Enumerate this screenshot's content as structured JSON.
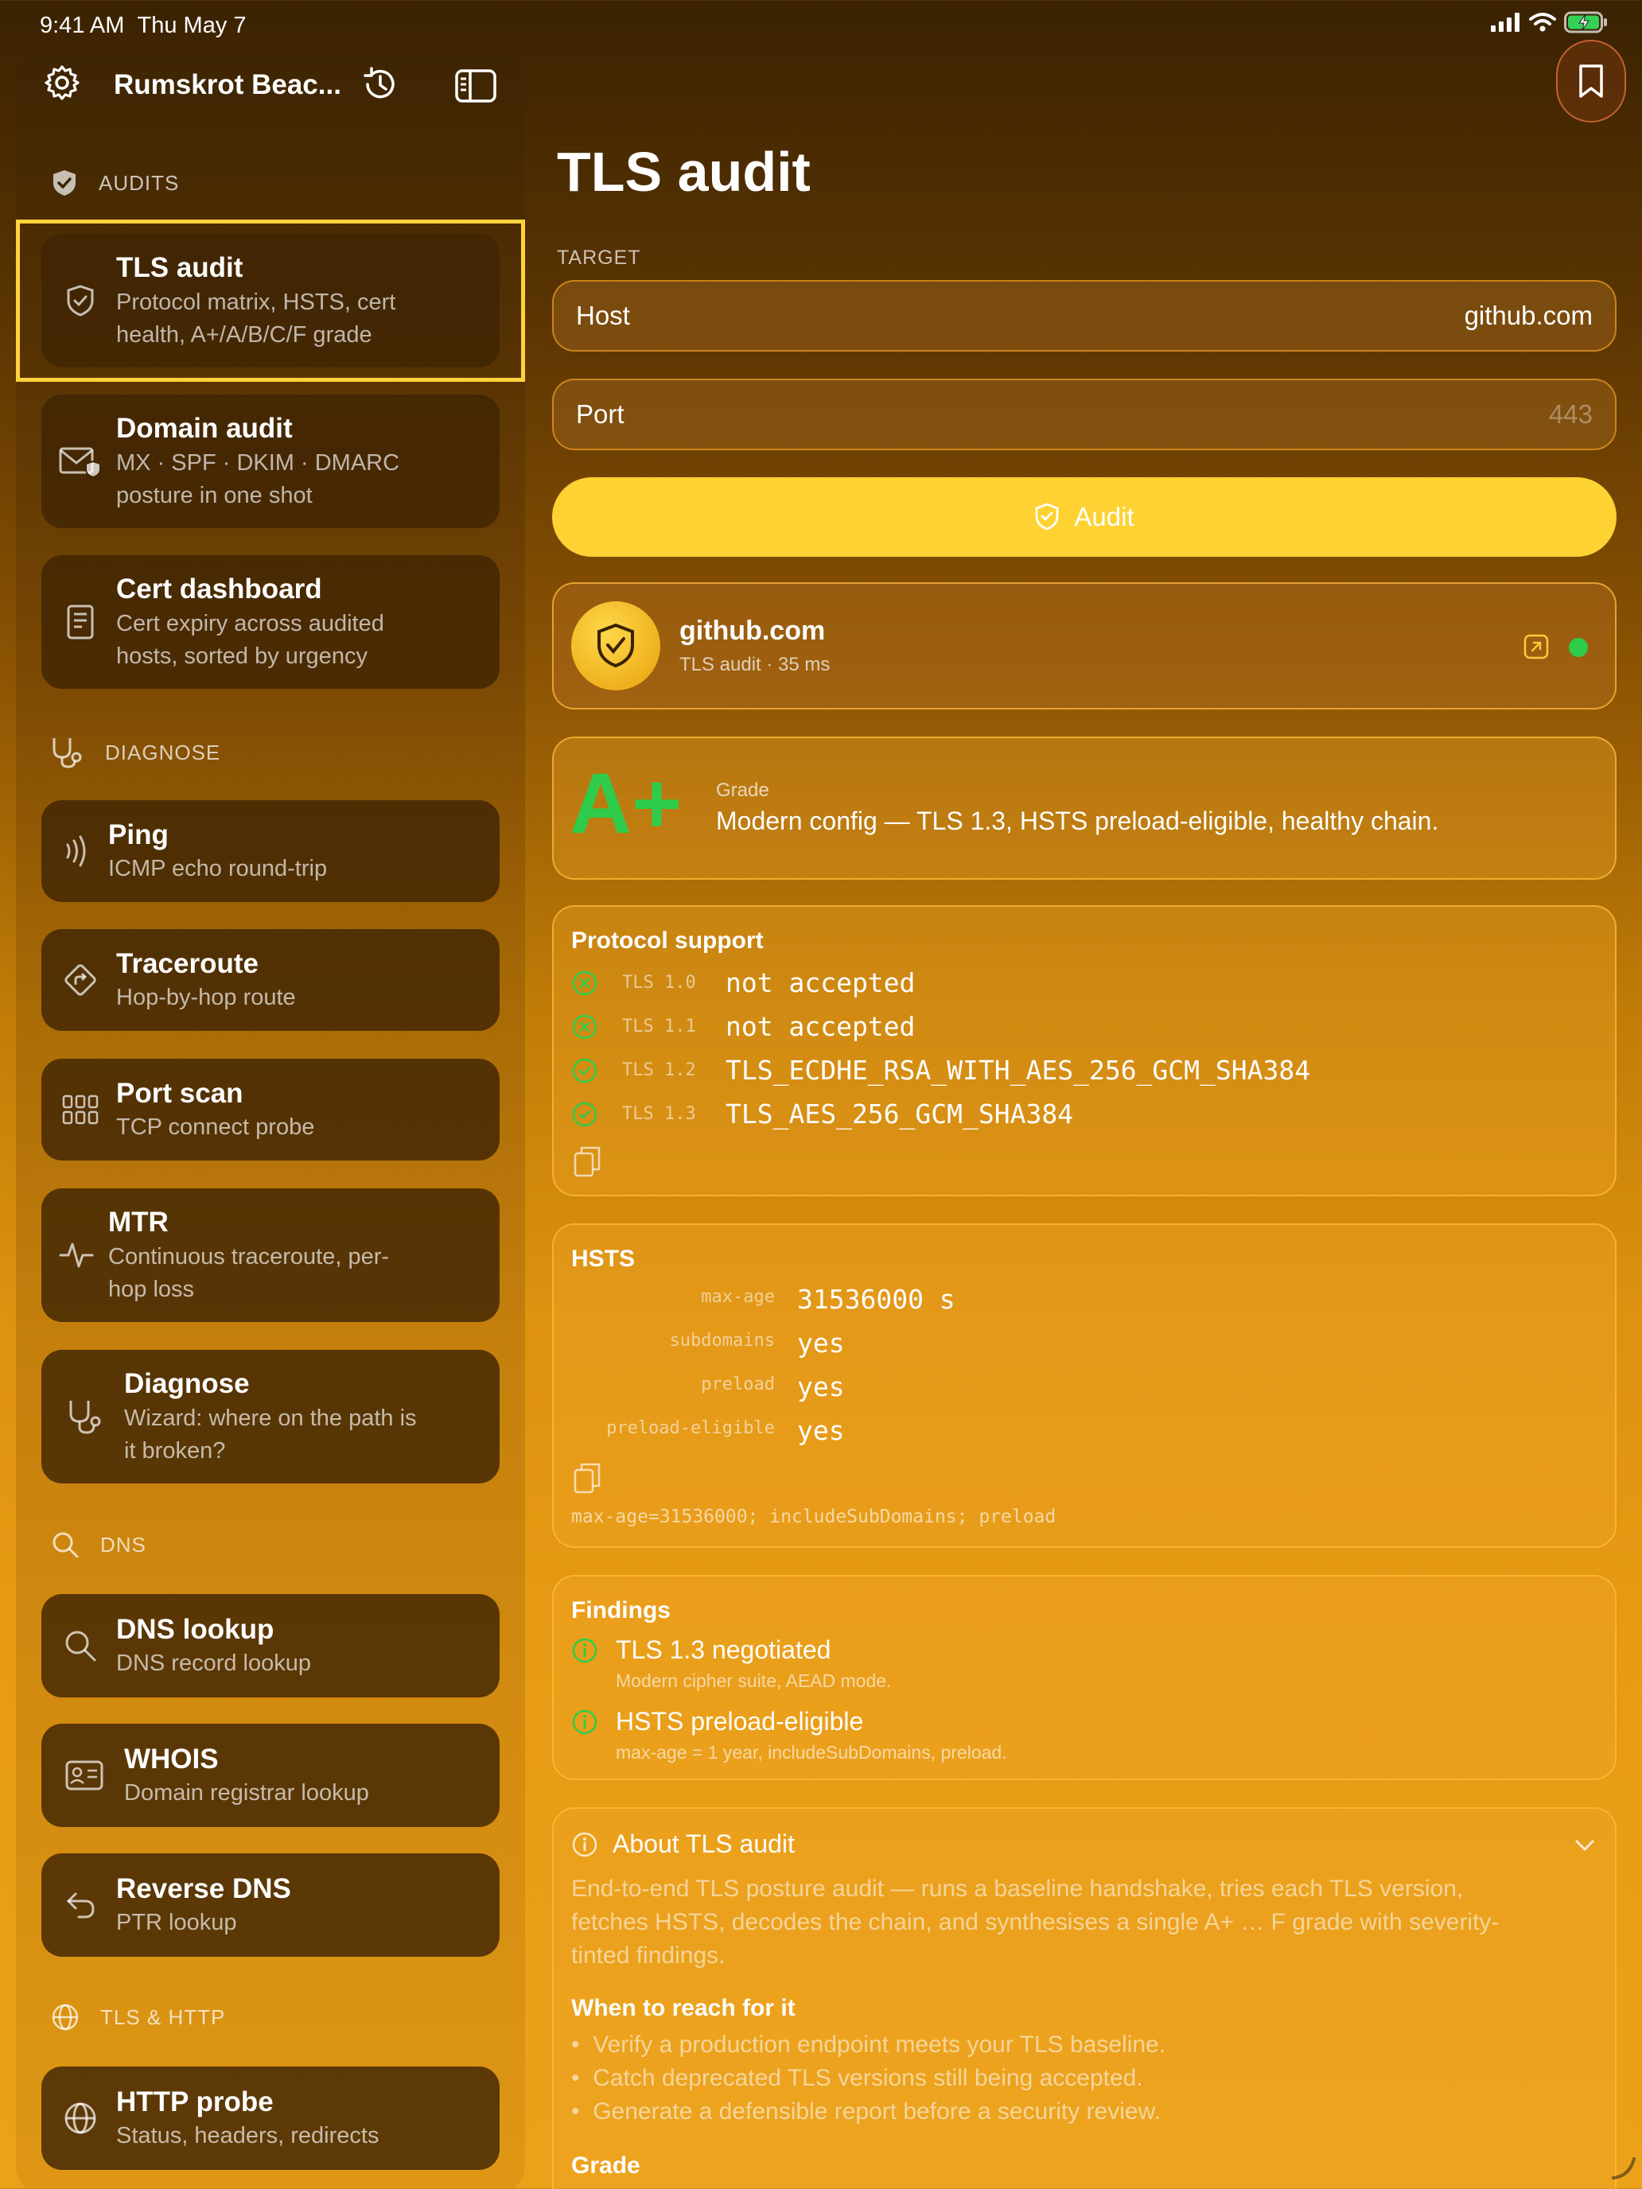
{
  "status_bar": {
    "time": "9:41 AM",
    "date": "Thu May 7"
  },
  "sidebar": {
    "workspace_title": "Rumskrot Beac...",
    "sections": {
      "audits": "AUDITS",
      "diagnose": "DIAGNOSE",
      "dns": "DNS",
      "tls_http": "TLS & HTTP"
    },
    "items": [
      {
        "title": "TLS audit",
        "subtitle_1": "Protocol matrix, HSTS, cert",
        "subtitle_2": "health, A+/A/B/C/F grade",
        "icon": "shield-check-icon"
      },
      {
        "title": "Domain audit",
        "subtitle_1": "MX · SPF · DKIM · DMARC",
        "subtitle_2": "posture in one shot",
        "icon": "envelope-shield-icon"
      },
      {
        "title": "Cert dashboard",
        "subtitle_1": "Cert expiry across audited",
        "subtitle_2": "hosts, sorted by urgency",
        "icon": "document-icon"
      },
      {
        "title": "Ping",
        "subtitle_1": "ICMP echo round-trip",
        "icon": "signal-waves-icon"
      },
      {
        "title": "Traceroute",
        "subtitle_1": "Hop-by-hop route",
        "icon": "route-diamond-icon"
      },
      {
        "title": "Port scan",
        "subtitle_1": "TCP connect probe",
        "icon": "grid-icon"
      },
      {
        "title": "MTR",
        "subtitle_1": "Continuous traceroute, per-",
        "subtitle_2": "hop loss",
        "icon": "pulse-icon"
      },
      {
        "title": "Diagnose",
        "subtitle_1": "Wizard: where on the path is",
        "subtitle_2": "it broken?",
        "icon": "stethoscope-icon"
      },
      {
        "title": "DNS lookup",
        "subtitle_1": "DNS record lookup",
        "icon": "search-icon"
      },
      {
        "title": "WHOIS",
        "subtitle_1": "Domain registrar lookup",
        "icon": "id-card-icon"
      },
      {
        "title": "Reverse DNS",
        "subtitle_1": "PTR lookup",
        "icon": "return-arrow-icon"
      },
      {
        "title": "HTTP probe",
        "subtitle_1": "Status, headers, redirects",
        "icon": "globe-icon"
      }
    ]
  },
  "main": {
    "title": "TLS audit",
    "target_label": "TARGET",
    "host_label": "Host",
    "host_value": "github.com",
    "port_label": "Port",
    "port_placeholder": "443",
    "audit_button": "Audit",
    "result": {
      "host": "github.com",
      "meta": "TLS audit · 35 ms"
    },
    "grade": {
      "letter": "A+",
      "label": "Grade",
      "summary": "Modern config — TLS 1.3, HSTS preload-eligible, healthy chain."
    },
    "protocol": {
      "title": "Protocol support",
      "rows": [
        {
          "version": "TLS 1.0",
          "value": "not accepted"
        },
        {
          "version": "TLS 1.1",
          "value": "not accepted"
        },
        {
          "version": "TLS 1.2",
          "value": "TLS_ECDHE_RSA_WITH_AES_256_GCM_SHA384"
        },
        {
          "version": "TLS 1.3",
          "value": "TLS_AES_256_GCM_SHA384"
        }
      ]
    },
    "hsts": {
      "title": "HSTS",
      "rows": [
        {
          "key": "max-age",
          "value": "31536000 s"
        },
        {
          "key": "subdomains",
          "value": "yes"
        },
        {
          "key": "preload",
          "value": "yes"
        },
        {
          "key": "preload-eligible",
          "value": "yes"
        }
      ],
      "raw": "max-age=31536000; includeSubDomains; preload"
    },
    "findings": {
      "title": "Findings",
      "items": [
        {
          "title": "TLS 1.3 negotiated",
          "detail": "Modern cipher suite, AEAD mode."
        },
        {
          "title": "HSTS preload-eligible",
          "detail": "max-age = 1 year, includeSubDomains, preload."
        }
      ]
    },
    "about": {
      "title": "About TLS audit",
      "body_1": "End-to-end TLS posture audit — runs a baseline handshake, tries each TLS version,",
      "body_2": "fetches HSTS, decodes the chain, and synthesises a single A+ … F grade with severity-",
      "body_3": "tinted findings.",
      "when_title": "When to reach for it",
      "bullets": [
        "Verify a production endpoint meets your TLS baseline.",
        "Catch deprecated TLS versions still being accepted.",
        "Generate a defensible report before a security review."
      ],
      "grade_title": "Grade"
    }
  },
  "colors": {
    "accent_yellow": "#ffd233",
    "success_green": "#2ecc4a",
    "selection_border": "#ffd23e"
  }
}
